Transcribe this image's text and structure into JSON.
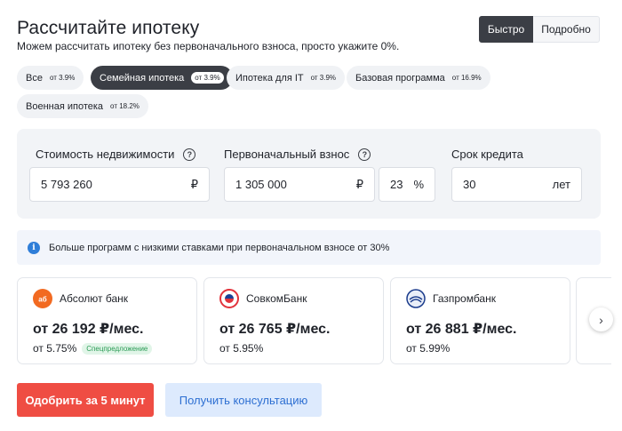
{
  "header": {
    "title": "Рассчитайте ипотеку",
    "subtitle": "Можем рассчитать ипотеку без первоначального взноса, просто укажите 0%."
  },
  "mode": {
    "quick_label": "Быстро",
    "detailed_label": "Подробно",
    "selected": "Быстро"
  },
  "programs": [
    {
      "label": "Все",
      "rate": "от 3.9%"
    },
    {
      "label": "Семейная ипотека",
      "rate": "от 3.9%",
      "active": true
    },
    {
      "label": "Ипотека для IT",
      "rate": "от 3.9%"
    },
    {
      "label": "Базовая программа",
      "rate": "от 16.9%"
    },
    {
      "label": "Военная ипотека",
      "rate": "от 18.2%"
    }
  ],
  "calculator": {
    "price": {
      "label": "Стоимость недвижимости",
      "value": "5 793 260",
      "unit": "₽"
    },
    "down_payment": {
      "label": "Первоначальный взнос",
      "value": "1 305 000",
      "unit": "₽",
      "percent": "23",
      "percent_unit": "%"
    },
    "term": {
      "label": "Срок кредита",
      "value": "30",
      "unit": "лет"
    }
  },
  "info": {
    "text": "Больше программ с низкими ставками при первоначальном взносе от 30%"
  },
  "banks": [
    {
      "name": "Абсолют банк",
      "payment": "от 26 192 ₽/мес.",
      "rate": "от 5.75%",
      "badge": "Спецпредложение",
      "logo_color": "#f26a21"
    },
    {
      "name": "СовкомБанк",
      "payment": "от 26 765 ₽/мес.",
      "rate": "от 5.95%",
      "logo_color": "#e2333c"
    },
    {
      "name": "Газпромбанк",
      "payment": "от 26 881 ₽/мес.",
      "rate": "от 5.99%",
      "logo_color": "#1b3c8c"
    }
  ],
  "actions": {
    "approve_label": "Одобрить за 5 минут",
    "consult_label": "Получить консультацию"
  },
  "colors": {
    "accent_red": "#ef4d43",
    "accent_blue": "#2d6fd2",
    "dark": "#3b3e45"
  }
}
